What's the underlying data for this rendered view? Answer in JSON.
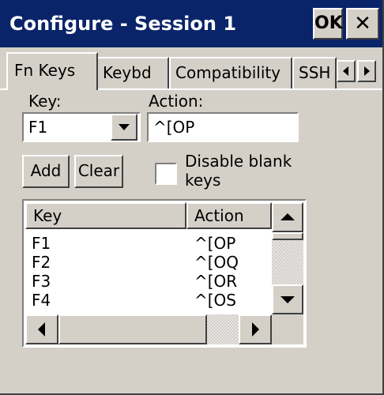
{
  "window": {
    "title": "Configure - Session 1",
    "ok_label": "OK",
    "close_glyph": "✕"
  },
  "tabs": [
    {
      "label": "Fn Keys",
      "active": true
    },
    {
      "label": "Keybd",
      "active": false
    },
    {
      "label": "Compatibility",
      "active": false
    },
    {
      "label": "SSH",
      "active": false
    }
  ],
  "tab_scroll": {
    "left_icon": "arrow-left-icon",
    "right_icon": "arrow-right-icon"
  },
  "form": {
    "key_label": "Key:",
    "key_value": "F1",
    "action_label": "Action:",
    "action_value": "^[OP",
    "add_label": "Add",
    "clear_label": "Clear",
    "disable_blank_label_line1": "Disable blank",
    "disable_blank_label_line2": "keys",
    "disable_blank_checked": false
  },
  "list": {
    "columns": [
      "Key",
      "Action"
    ],
    "rows": [
      {
        "key": "F1",
        "action": "^[OP"
      },
      {
        "key": "F2",
        "action": "^[OQ"
      },
      {
        "key": "F3",
        "action": "^[OR"
      },
      {
        "key": "F4",
        "action": "^[OS"
      }
    ]
  }
}
